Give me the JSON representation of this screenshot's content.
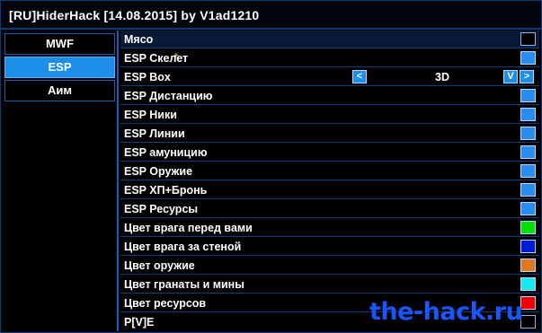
{
  "window": {
    "title": "[RU]HiderHack [14.08.2015] by V1ad1210"
  },
  "sidebar": {
    "items": [
      {
        "label": "MWF",
        "active": false
      },
      {
        "label": "ESP",
        "active": true
      },
      {
        "label": "Аим",
        "active": false
      }
    ]
  },
  "settings": {
    "rows": [
      {
        "label": "Мясо",
        "checked": false
      },
      {
        "label": "ESP Скелет",
        "checked": true
      },
      {
        "label": "ESP Box",
        "selector_value": "3D",
        "prev": "<",
        "dropdown": "V",
        "next": ">"
      },
      {
        "label": "ESP Дистанцию",
        "checked": true
      },
      {
        "label": "ESP Ники",
        "checked": true
      },
      {
        "label": "ESP Линии",
        "checked": true
      },
      {
        "label": "ESP амуницию",
        "checked": true
      },
      {
        "label": "ESP Оружие",
        "checked": true
      },
      {
        "label": "ESP ХП+Бронь",
        "checked": true
      },
      {
        "label": "ESP Ресурсы",
        "checked": true
      },
      {
        "label": "Цвет врага перед вами",
        "color": "#00e000"
      },
      {
        "label": "Цвет врага за стеной",
        "color": "#0018d8"
      },
      {
        "label": "Цвет оружие",
        "color": "#e07820"
      },
      {
        "label": "Цвет гранаты и мины",
        "color": "#18e8f0"
      },
      {
        "label": "Цвет ресурсов",
        "color": "#f00000"
      },
      {
        "label": "P[V]E",
        "checked": false
      }
    ]
  },
  "watermark": "the-hack.ru",
  "colors": {
    "accent": "#1e8fe8",
    "border": "#0a3a7a",
    "background": "#000000"
  }
}
